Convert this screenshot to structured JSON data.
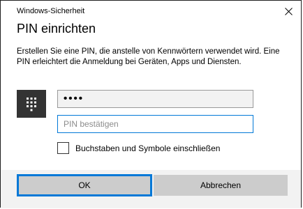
{
  "window": {
    "title": "Windows-Sicherheit"
  },
  "dialog": {
    "heading": "PIN einrichten",
    "description": "Erstellen Sie eine PIN, die anstelle von Kennwörtern verwendet wird. Eine PIN erleichtert die Anmeldung bei Geräten, Apps und Diensten."
  },
  "form": {
    "pin_value": "••••",
    "confirm_placeholder": "PIN bestätigen",
    "confirm_value": "",
    "checkbox_label": "Buchstaben und Symbole einschließen",
    "checkbox_checked": false
  },
  "buttons": {
    "ok_label": "OK",
    "cancel_label": "Abbrechen"
  },
  "colors": {
    "accent": "#0078d7",
    "button_bg": "#cccccc",
    "footer_bg": "#f2f2f2",
    "keypad_tile": "#333333"
  },
  "icons": {
    "close": "close-icon",
    "keypad": "keypad-icon"
  }
}
